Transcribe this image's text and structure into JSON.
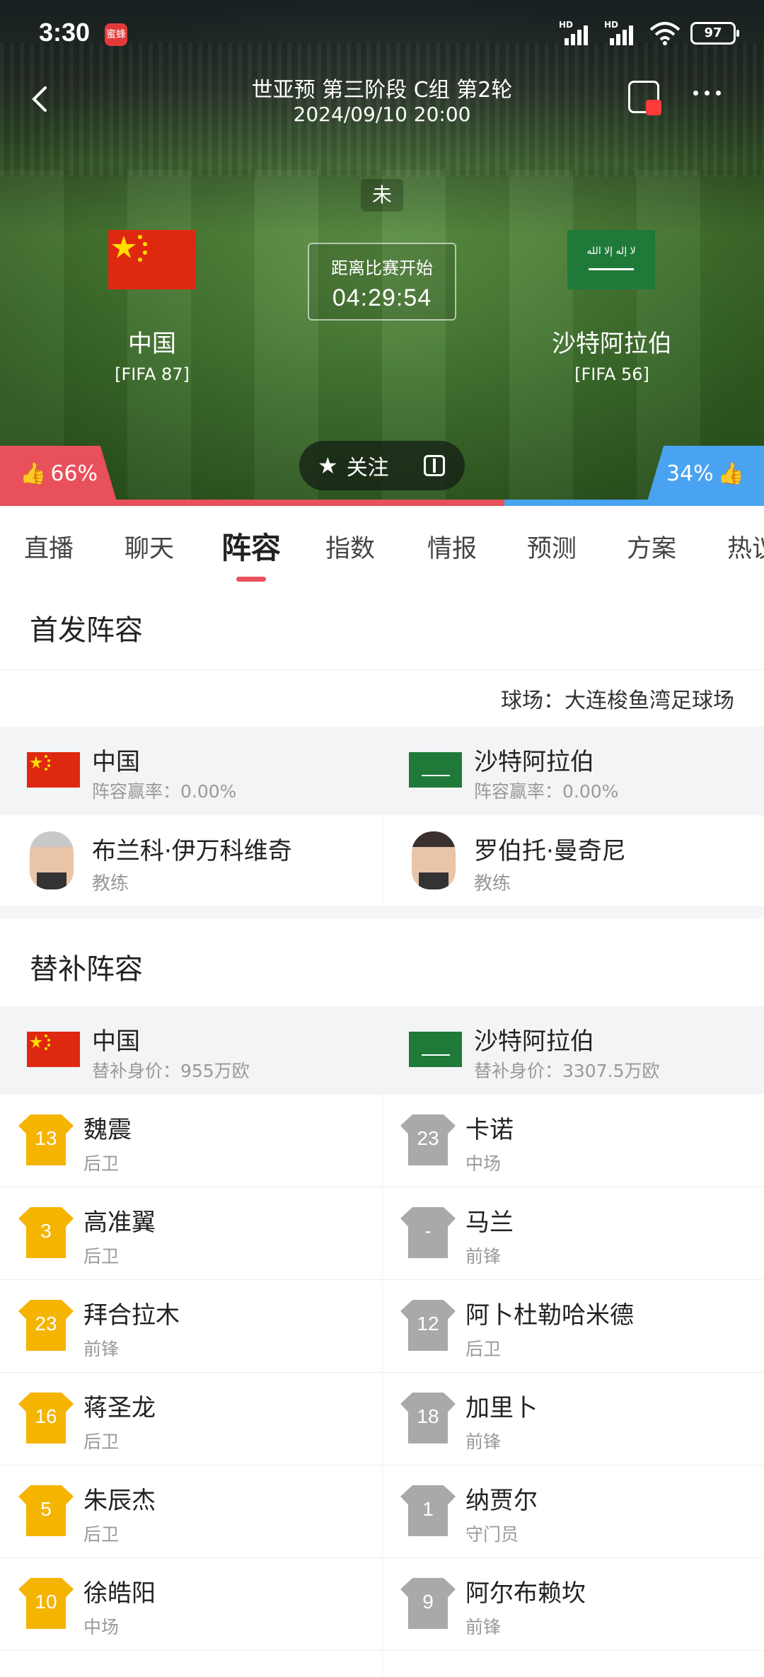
{
  "status_bar": {
    "time": "3:30",
    "badge": "蜜蜂",
    "hd1": "HD",
    "hd2": "HD",
    "battery": "97"
  },
  "header": {
    "title": "世亚预 第三阶段 C组 第2轮",
    "datetime": "2024/09/10 20:00"
  },
  "match": {
    "status": "未",
    "countdown_label": "距离比赛开始",
    "countdown": "04:29:54",
    "home": {
      "name": "中国",
      "fifa": "[FIFA 87]",
      "flag_color": "#de2910"
    },
    "away": {
      "name": "沙特阿拉伯",
      "fifa": "[FIFA 56]",
      "flag_color": "#1f7a3a",
      "flag_script": "ﻻ ﺇﻟﻪ ﺇﻻ ﺍﻟﻠﻪ"
    },
    "follow_label": "关注",
    "vote_home": "66%",
    "vote_away": "34%",
    "vote_home_fraction": 0.66
  },
  "tabs": [
    "直播",
    "聊天",
    "阵容",
    "指数",
    "情报",
    "预测",
    "方案",
    "热议"
  ],
  "active_tab": "阵容",
  "starting": {
    "title": "首发阵容",
    "venue": "球场：大连梭鱼湾足球场",
    "home": {
      "name": "中国",
      "rate": "阵容赢率：0.00%"
    },
    "away": {
      "name": "沙特阿拉伯",
      "rate": "阵容赢率：0.00%"
    },
    "home_coach": {
      "name": "布兰科·伊万科维奇",
      "role": "教练"
    },
    "away_coach": {
      "name": "罗伯托·曼奇尼",
      "role": "教练"
    }
  },
  "subs": {
    "title": "替补阵容",
    "home": {
      "name": "中国",
      "value": "替补身价：955万欧"
    },
    "away": {
      "name": "沙特阿拉伯",
      "value": "替补身价：3307.5万欧"
    },
    "home_players": [
      {
        "num": "13",
        "name": "魏震",
        "pos": "后卫"
      },
      {
        "num": "3",
        "name": "高准翼",
        "pos": "后卫"
      },
      {
        "num": "23",
        "name": "拜合拉木",
        "pos": "前锋"
      },
      {
        "num": "16",
        "name": "蒋圣龙",
        "pos": "后卫"
      },
      {
        "num": "5",
        "name": "朱辰杰",
        "pos": "后卫"
      },
      {
        "num": "10",
        "name": "徐皓阳",
        "pos": "中场"
      }
    ],
    "away_players": [
      {
        "num": "23",
        "name": "卡诺",
        "pos": "中场"
      },
      {
        "num": "-",
        "name": "马兰",
        "pos": "前锋"
      },
      {
        "num": "12",
        "name": "阿卜杜勒哈米德",
        "pos": "后卫"
      },
      {
        "num": "18",
        "name": "加里卜",
        "pos": "前锋"
      },
      {
        "num": "1",
        "name": "纳贾尔",
        "pos": "守门员"
      },
      {
        "num": "9",
        "name": "阿尔布赖坎",
        "pos": "前锋"
      }
    ]
  },
  "colors": {
    "accent": "#e8505b",
    "home_jersey": "#f5b400",
    "away_jersey": "#a9a9a9",
    "away_vote": "#4aa3f0"
  }
}
